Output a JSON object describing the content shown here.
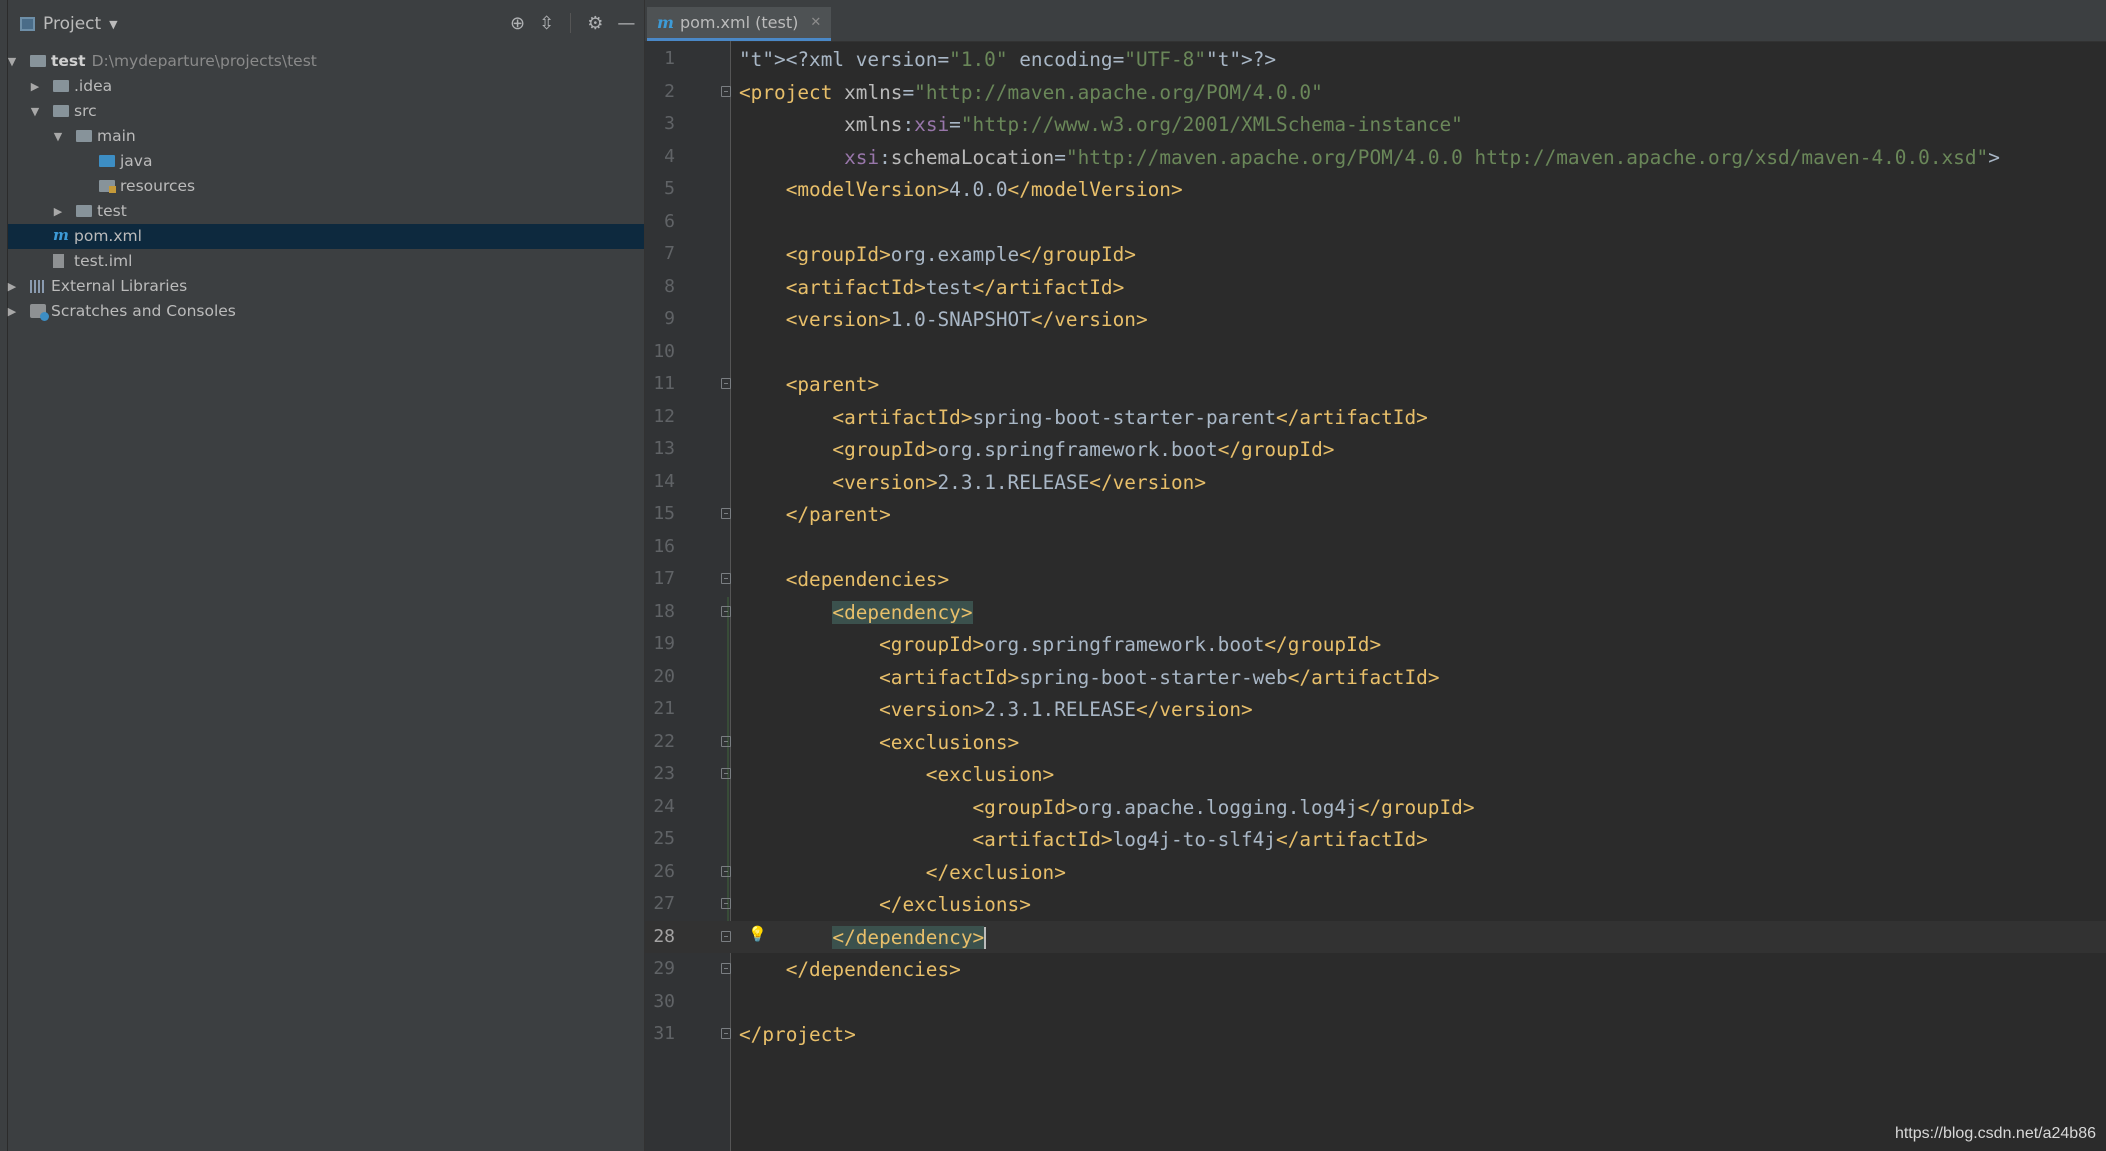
{
  "project_panel": {
    "title": "Project",
    "header_icons": [
      "locate-icon",
      "collapse-icon",
      "gear-icon",
      "minimize-icon"
    ]
  },
  "tree": [
    {
      "label": "test",
      "path": "D:\\mydeparture\\projects\\test",
      "icon": "module-folder-icon",
      "expanded": true,
      "depth": 0
    },
    {
      "label": ".idea",
      "icon": "folder-icon",
      "expanded": false,
      "depth": 1
    },
    {
      "label": "src",
      "icon": "folder-icon",
      "expanded": true,
      "depth": 1
    },
    {
      "label": "main",
      "icon": "folder-icon",
      "expanded": true,
      "depth": 2
    },
    {
      "label": "java",
      "icon": "source-folder-icon",
      "depth": 3
    },
    {
      "label": "resources",
      "icon": "resources-folder-icon",
      "depth": 3
    },
    {
      "label": "test",
      "icon": "folder-icon",
      "expanded": false,
      "depth": 2
    },
    {
      "label": "pom.xml",
      "icon": "maven-icon",
      "depth": 1,
      "selected": true
    },
    {
      "label": "test.iml",
      "icon": "iml-file-icon",
      "depth": 1
    },
    {
      "label": "External Libraries",
      "icon": "libraries-icon",
      "expanded": false,
      "depth": 0
    },
    {
      "label": "Scratches and Consoles",
      "icon": "scratches-icon",
      "expanded": false,
      "depth": 0
    }
  ],
  "editor": {
    "tab_label": "pom.xml (test)",
    "current_line": 28,
    "line_numbers": [
      "1",
      "2",
      "3",
      "4",
      "5",
      "6",
      "7",
      "8",
      "9",
      "10",
      "11",
      "12",
      "13",
      "14",
      "15",
      "16",
      "17",
      "18",
      "19",
      "20",
      "21",
      "22",
      "23",
      "24",
      "25",
      "26",
      "27",
      "28",
      "29",
      "30",
      "31"
    ],
    "code": [
      "<?xml version=\"1.0\" encoding=\"UTF-8\"?>",
      "<project xmlns=\"http://maven.apache.org/POM/4.0.0\"",
      "         xmlns:xsi=\"http://www.w3.org/2001/XMLSchema-instance\"",
      "         xsi:schemaLocation=\"http://maven.apache.org/POM/4.0.0 http://maven.apache.org/xsd/maven-4.0.0.xsd\">",
      "    <modelVersion>4.0.0</modelVersion>",
      "",
      "    <groupId>org.example</groupId>",
      "    <artifactId>test</artifactId>",
      "    <version>1.0-SNAPSHOT</version>",
      "",
      "    <parent>",
      "        <artifactId>spring-boot-starter-parent</artifactId>",
      "        <groupId>org.springframework.boot</groupId>",
      "        <version>2.3.1.RELEASE</version>",
      "    </parent>",
      "",
      "    <dependencies>",
      "        <dependency>",
      "            <groupId>org.springframework.boot</groupId>",
      "            <artifactId>spring-boot-starter-web</artifactId>",
      "            <version>2.3.1.RELEASE</version>",
      "            <exclusions>",
      "                <exclusion>",
      "                    <groupId>org.apache.logging.log4j</groupId>",
      "                    <artifactId>log4j-to-slf4j</artifactId>",
      "                </exclusion>",
      "            </exclusions>",
      "        </dependency>",
      "    </dependencies>",
      "",
      "</project>"
    ],
    "fold_lines": [
      2,
      11,
      15,
      17,
      18,
      22,
      23,
      26,
      27,
      28,
      29,
      31
    ]
  },
  "watermark": "https://blog.csdn.net/a24b86",
  "colors": {
    "tag": "#e8bf6a",
    "string": "#6a8759",
    "namespace": "#9876aa",
    "text": "#a9b7c6",
    "selection": "#0d293e",
    "brace_highlight": "#3b514d"
  }
}
